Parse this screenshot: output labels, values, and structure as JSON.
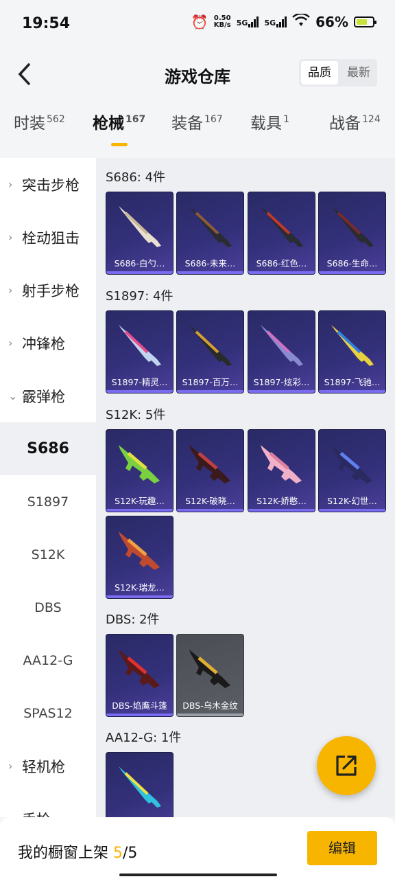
{
  "status": {
    "time": "19:54",
    "net_speed_value": "0.50",
    "net_speed_unit": "KB/s",
    "sim1": "5G",
    "sim2": "5G",
    "battery_pct": "66%",
    "battery_level": 0.66
  },
  "header": {
    "title": "游戏仓库",
    "sort_quality": "品质",
    "sort_latest": "最新"
  },
  "tabs": [
    {
      "label": "时装",
      "count": "562"
    },
    {
      "label": "枪械",
      "count": "167"
    },
    {
      "label": "装备",
      "count": "167"
    },
    {
      "label": "载具",
      "count": "1"
    },
    {
      "label": "战备",
      "count": "124"
    }
  ],
  "sidebar": {
    "groups": [
      "突击步枪",
      "栓动狙击",
      "射手步枪",
      "冲锋枪",
      "霰弹枪",
      "轻机枪",
      "手枪"
    ],
    "sub_items": [
      "S686",
      "S1897",
      "S12K",
      "DBS",
      "AA12-G",
      "SPAS12"
    ]
  },
  "sections": [
    {
      "title": "S686: 4件",
      "items": [
        "S686-白勺…",
        "S686-未来…",
        "S686-红色…",
        "S686-生命…"
      ]
    },
    {
      "title": "S1897: 4件",
      "items": [
        "S1897-精灵…",
        "S1897-百万…",
        "S1897-炫彩…",
        "S1897-飞驰…"
      ]
    },
    {
      "title": "S12K: 5件",
      "items": [
        "S12K-玩趣…",
        "S12K-破晓…",
        "S12K-娇憨…",
        "S12K-幻世…",
        "S12K-瑞龙…"
      ]
    },
    {
      "title": "DBS: 2件",
      "items": [
        "DBS-焰鹰斗篷",
        "DBS-乌木金纹"
      ]
    },
    {
      "title": "AA12-G: 1件",
      "items": [
        ""
      ]
    }
  ],
  "bottom": {
    "showcase_label": "我的橱窗上架",
    "showcase_current": "5",
    "showcase_total": "/5",
    "edit_label": "编辑"
  },
  "colors": {
    "accent": "#f7b500",
    "card_purple": "#33307a",
    "card_grey": "#5c5e66"
  }
}
